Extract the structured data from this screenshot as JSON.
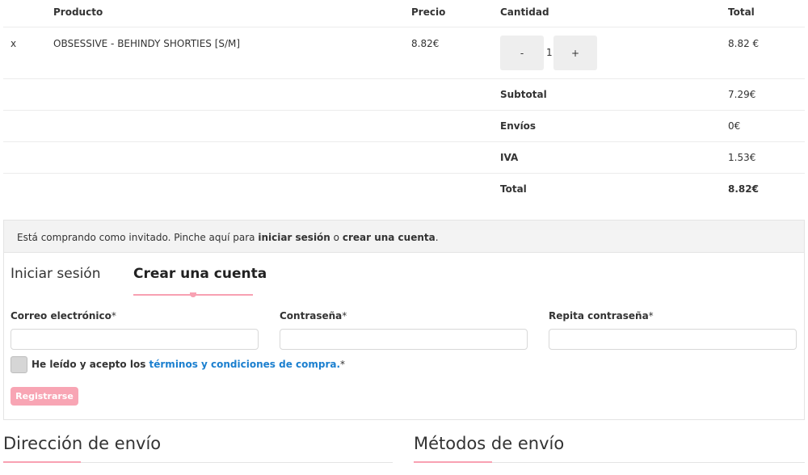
{
  "cart": {
    "headers": {
      "product": "Producto",
      "price": "Precio",
      "quantity": "Cantidad",
      "total": "Total"
    },
    "items": [
      {
        "remove": "x",
        "product": "OBSESSIVE - BEHINDY SHORTIES [S/M]",
        "price": "8.82€",
        "minus": "-",
        "quantity": "1",
        "plus": "+",
        "total": "8.82 €"
      }
    ],
    "summary": {
      "subtotal_label": "Subtotal",
      "subtotal_value": "7.29€",
      "shipping_label": "Envíos",
      "shipping_value": "0€",
      "tax_label": "IVA",
      "tax_value": "1.53€",
      "total_label": "Total",
      "total_value": "8.82€"
    }
  },
  "notice": {
    "text_before": "Está comprando como invitado. Pinche aquí para ",
    "login_link": "iniciar sesión",
    "text_mid": " o ",
    "register_link": "crear una cuenta",
    "text_end": "."
  },
  "account": {
    "tabs": {
      "login": "Iniciar sesión",
      "register": "Crear una cuenta"
    },
    "fields": {
      "email_label": "Correo electrónico",
      "password_label": "Contraseña",
      "repeat_label": "Repita contraseña",
      "required_mark": "*"
    },
    "terms": {
      "text": "He leído y acepto los ",
      "link": "términos y condiciones de compra.",
      "required_mark": "*"
    },
    "register_button": "Registrarse"
  },
  "sections": {
    "shipping_address": "Dirección de envío",
    "shipping_methods": "Métodos de envío"
  },
  "colors": {
    "accent": "#f8a1b2",
    "link": "#1b7fcf"
  }
}
